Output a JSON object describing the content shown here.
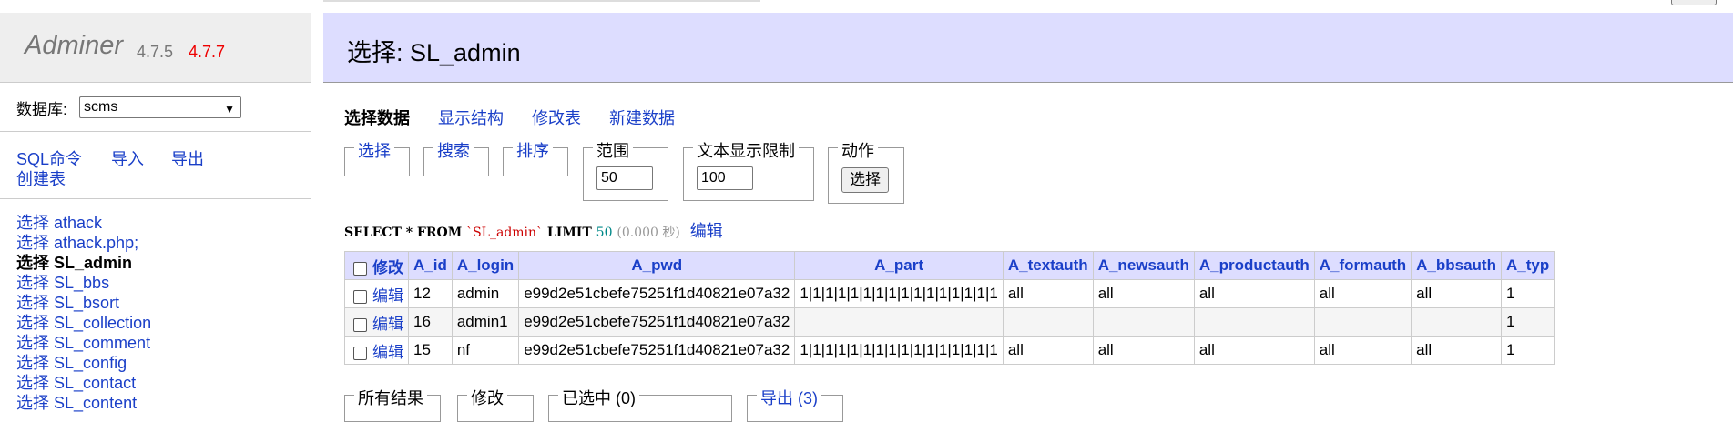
{
  "sidebar": {
    "app_name": "Adminer",
    "version_current": "4.7.5",
    "version_latest": "4.7.7",
    "db_label": "数据库:",
    "db_selected": "scms",
    "commands": {
      "sql": "SQL命令",
      "import": "导入",
      "export": "导出",
      "create_table": "创建表"
    },
    "select_word": "选择",
    "tables": [
      "athack",
      "athack.php;",
      "SL_admin",
      "SL_bbs",
      "SL_bsort",
      "SL_collection",
      "SL_comment",
      "SL_config",
      "SL_contact",
      "SL_content"
    ]
  },
  "header": {
    "title": "选择: SL_admin"
  },
  "tabs": {
    "select_data": "选择数据",
    "show_structure": "显示结构",
    "alter_table": "修改表",
    "new_item": "新建数据"
  },
  "filters": {
    "select": "选择",
    "search": "搜索",
    "sort": "排序",
    "limit_legend": "范围",
    "limit_value": "50",
    "text_length_legend": "文本显示限制",
    "text_length_value": "100",
    "action_legend": "动作",
    "action_button": "选择"
  },
  "query": {
    "prefix": "SELECT * FROM",
    "table": "`SL_admin`",
    "limit_kw": "LIMIT",
    "limit_num": "50",
    "time": "(0.000 秒)",
    "edit": "编辑"
  },
  "table": {
    "modify_header": "修改",
    "columns": [
      "A_id",
      "A_login",
      "A_pwd",
      "A_part",
      "A_textauth",
      "A_newsauth",
      "A_productauth",
      "A_formauth",
      "A_bbsauth",
      "A_typ"
    ],
    "edit_label": "编辑",
    "rows": [
      [
        "12",
        "admin",
        "e99d2e51cbefe75251f1d40821e07a32",
        "1|1|1|1|1|1|1|1|1|1|1|1|1|1|1|1",
        "all",
        "all",
        "all",
        "all",
        "all",
        "1"
      ],
      [
        "16",
        "admin1",
        "e99d2e51cbefe75251f1d40821e07a32",
        "",
        "",
        "",
        "",
        "",
        "",
        "1"
      ],
      [
        "15",
        "nf",
        "e99d2e51cbefe75251f1d40821e07a32",
        "1|1|1|1|1|1|1|1|1|1|1|1|1|1|1|1",
        "all",
        "all",
        "all",
        "all",
        "all",
        "1"
      ]
    ]
  },
  "bottom": {
    "all_results": "所有结果",
    "modify": "修改",
    "selected": "已选中 (0)",
    "export": "导出 (3)"
  }
}
